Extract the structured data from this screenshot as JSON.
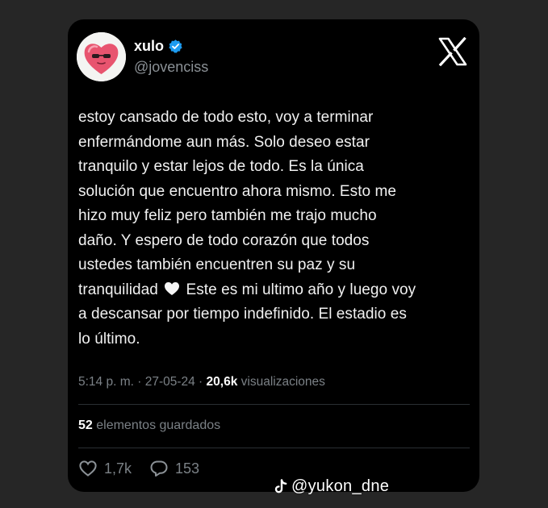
{
  "post": {
    "author": {
      "display_name": "xulo",
      "handle": "@jovenciss",
      "verified": true
    },
    "body_lines": [
      "estoy cansado de todo esto, voy a terminar",
      "enfermándome aun más. Solo deseo estar",
      "tranquilo y estar lejos de todo. Es la única",
      "solución que encuentro ahora mismo. Esto me",
      "hizo muy feliz pero también me trajo mucho",
      "daño. Y espero de todo corazón que todos",
      "ustedes también encuentren su paz y su"
    ],
    "body_line_heart_before": "tranquilidad",
    "body_line_heart_after": "Este es mi ultimo año y luego voy",
    "body_lines_end": [
      "a descansar por tiempo indefinido. El estadio es",
      "lo último."
    ],
    "meta": {
      "time_date": "5:14 p. m. · 27-05-24 · ",
      "views_count": "20,6k",
      "views_label": " visualizaciones"
    },
    "saved": {
      "count": "52",
      "label": " elementos guardados"
    },
    "actions": {
      "likes": "1,7k",
      "replies": "153"
    }
  },
  "watermark": {
    "text": "@yukon_dne"
  },
  "icons": {
    "avatar": "heart-avatar-icon",
    "verified": "verified-badge-icon",
    "brand": "x-logo-icon",
    "inline_heart": "white-heart-emoji-icon",
    "like": "heart-outline-icon",
    "reply": "speech-bubble-icon",
    "watermark": "tiktok-icon"
  },
  "colors": {
    "card_background": "#000000",
    "page_background": "#262626",
    "verified_badge": "#1d9bf0",
    "secondary_text": "#7b8186",
    "avatar_heart": "#e8546f"
  }
}
